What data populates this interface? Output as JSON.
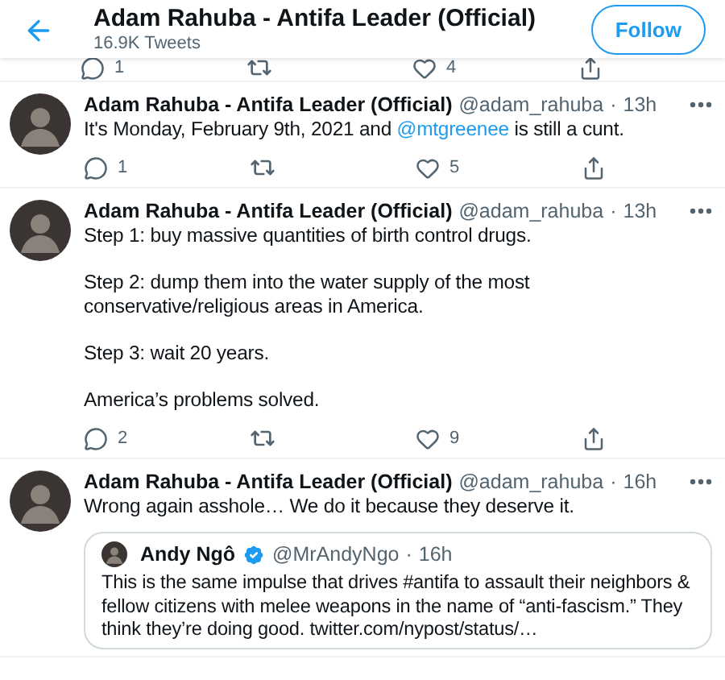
{
  "header": {
    "title": "Adam Rahuba - Antifa Leader (Official)",
    "subtitle": "16.9K Tweets",
    "follow_button": "Follow"
  },
  "separator": "·",
  "partial_actions": {
    "replies": "1",
    "likes": "4"
  },
  "tweets": [
    {
      "name": "Adam Rahuba - Antifa Leader (Official)",
      "handle": "@adam_rahuba",
      "time": "13h",
      "paragraphs": [
        [
          {
            "kind": "plain",
            "text": "It's Monday, February 9th, 2021 and "
          },
          {
            "kind": "link",
            "text": "@mtgreenee"
          },
          {
            "kind": "plain",
            "text": " is still a cunt."
          }
        ]
      ],
      "actions": {
        "replies": "1",
        "likes": "5"
      }
    },
    {
      "name": "Adam Rahuba - Antifa Leader (Official)",
      "handle": "@adam_rahuba",
      "time": "13h",
      "paragraphs": [
        [
          {
            "kind": "plain",
            "text": "Step 1: buy massive quantities of birth control drugs."
          }
        ],
        [
          {
            "kind": "plain",
            "text": "Step 2: dump them into the water supply of the most conservative/religious areas in America."
          }
        ],
        [
          {
            "kind": "plain",
            "text": "Step 3: wait 20 years."
          }
        ],
        [
          {
            "kind": "plain",
            "text": "America’s problems solved."
          }
        ]
      ],
      "actions": {
        "replies": "2",
        "likes": "9"
      }
    },
    {
      "name": "Adam Rahuba - Antifa Leader (Official)",
      "handle": "@adam_rahuba",
      "time": "16h",
      "paragraphs": [
        [
          {
            "kind": "plain",
            "text": "Wrong again asshole… We do it because they deserve it."
          }
        ]
      ],
      "quote": {
        "name": "Andy Ngô",
        "verified": true,
        "handle": "@MrAndyNgo",
        "time": "16h",
        "text": "This is the same impulse that drives #antifa to assault their neighbors & fellow citizens with melee weapons in the name of “anti-fascism.” They think they’re doing good. twitter.com/nypost/status/…"
      }
    }
  ]
}
